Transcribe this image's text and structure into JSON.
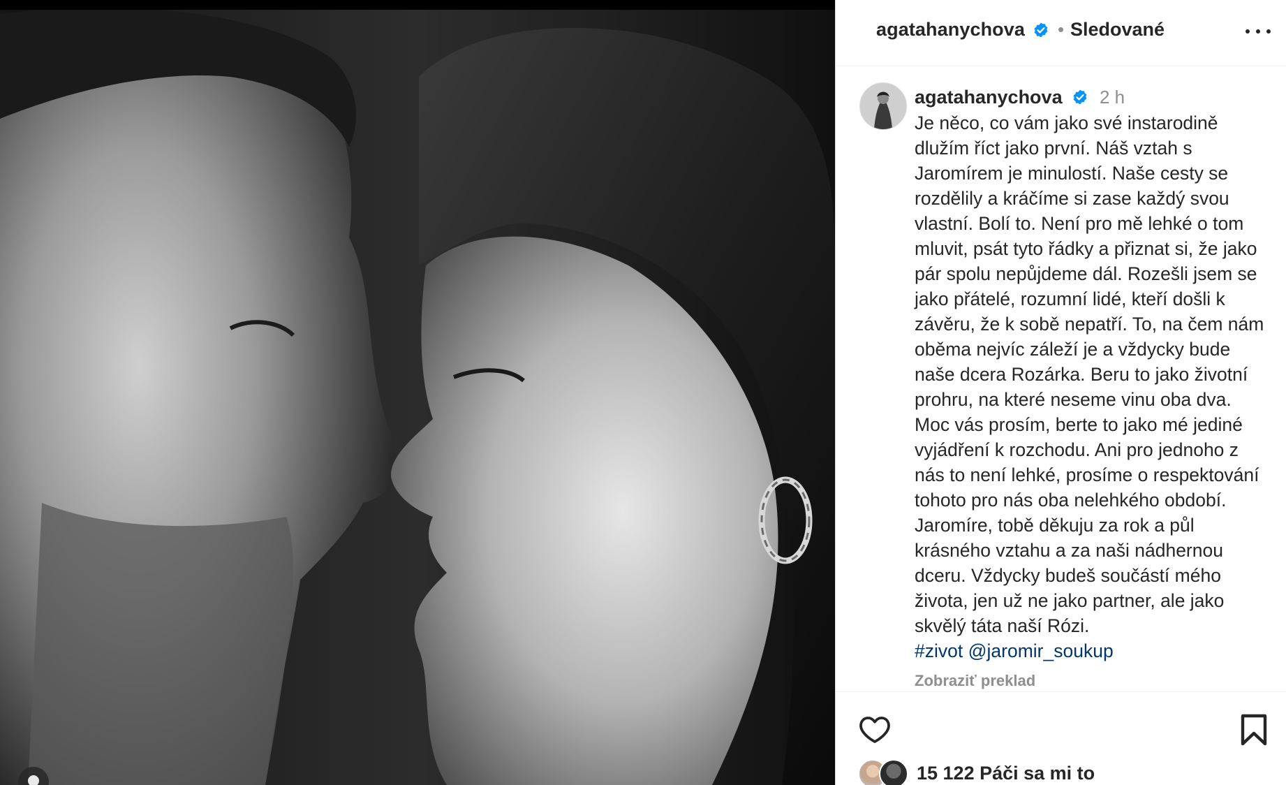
{
  "colors": {
    "text_primary": "#262626",
    "text_secondary": "#8e8e8e",
    "link": "#00376b",
    "verified_badge": "#0095f6",
    "divider": "#efefef"
  },
  "photo": {
    "icon": "carousel-indicator-icon"
  },
  "header": {
    "username": "agatahanychova",
    "verified_icon": "verified-badge-icon",
    "separator": "•",
    "follow_status": "Sledované",
    "more_icon": "more-options-icon"
  },
  "caption": {
    "username": "agatahanychova",
    "time": "2 h",
    "lines": [
      "Je něco, co vám jako své instarodině",
      "dlužím říct jako první. Náš vztah s",
      "Jaromírem je minulostí. Naše cesty se",
      "rozdělily a kráčíme si zase každý svou",
      "vlastní. Bolí to. Není pro mě lehké o tom",
      "mluvit, psát tyto řádky a přiznat si, že jako",
      "pár spolu nepůjdeme dál. Rozešli jsem se",
      "jako přátelé, rozumní lidé, kteří došli k",
      "závěru, že k sobě nepatří. To, na čem nám",
      "oběma nejvíc záleží je a vždycky bude",
      "naše dcera Rozárka. Beru to jako životní",
      "prohru, na které neseme vinu oba dva.",
      "Moc vás prosím, berte to jako mé jediné",
      "vyjádření k rozchodu. Ani pro jednoho z",
      "nás to není lehké, prosíme o respektování",
      "tohoto pro nás oba nelehkého období.",
      "Jaromíre, tobě děkuju za rok a půl",
      "krásného vztahu a za naši nádhernou",
      "dceru. Vždycky budeš součástí mého",
      "života, jen už ne jako partner, ale jako",
      "skvělý táta naší Rózi."
    ],
    "hashtag": "#zivot",
    "mention": "@jaromir_soukup",
    "translate": "Zobraziť preklad"
  },
  "actions": {
    "like_icon": "heart-icon",
    "save_icon": "bookmark-icon",
    "likes_text": "15 122 Páči sa mi to"
  }
}
